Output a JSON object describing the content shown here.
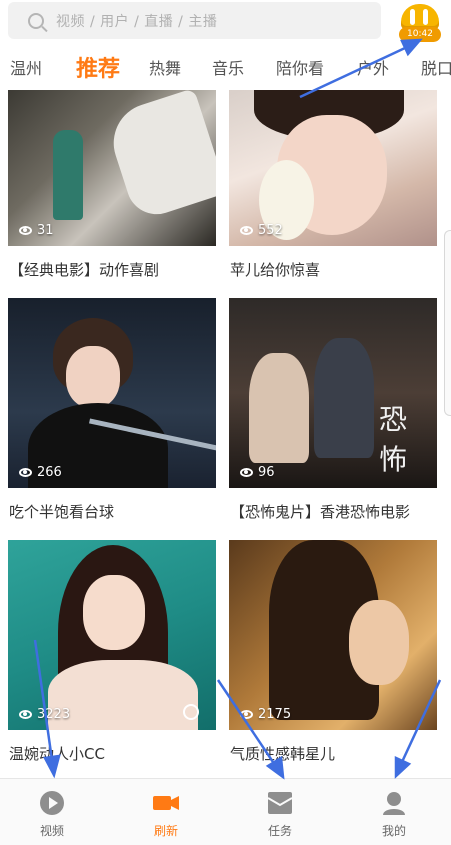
{
  "search": {
    "placeholder": "视频 / 用户 / 直播 / 主播"
  },
  "live_badge": {
    "time": "10:42"
  },
  "tabs": [
    {
      "label": "温州"
    },
    {
      "label": "推荐"
    },
    {
      "label": "热舞"
    },
    {
      "label": "音乐"
    },
    {
      "label": "陪你看"
    },
    {
      "label": "户外"
    },
    {
      "label": "脱口"
    }
  ],
  "feed": [
    {
      "title": "【经典电影】动作喜剧",
      "views": "31"
    },
    {
      "title": "苹儿给你惊喜",
      "views": "552"
    },
    {
      "title": "吃个半饱看台球",
      "views": "266"
    },
    {
      "title": "【恐怖鬼片】香港恐怖电影",
      "views": "96"
    },
    {
      "title": "温婉动人小CC",
      "views": "3223"
    },
    {
      "title": "气质性感韩星儿",
      "views": "2175"
    }
  ],
  "nav": [
    {
      "label": "视频",
      "icon": "play-circle-icon"
    },
    {
      "label": "刷新",
      "icon": "camera-icon"
    },
    {
      "label": "任务",
      "icon": "envelope-icon"
    },
    {
      "label": "我的",
      "icon": "person-icon"
    }
  ],
  "colors": {
    "accent": "#ff7a14",
    "arrow": "#3f6ee0"
  }
}
